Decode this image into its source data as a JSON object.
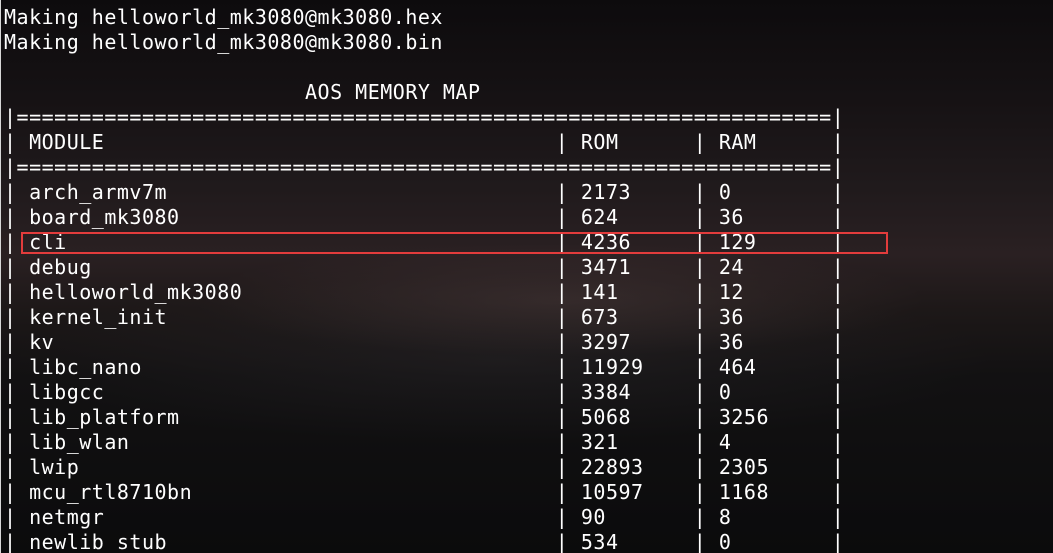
{
  "lines": [
    "Making helloworld_mk3080@mk3080.hex",
    "Making helloworld_mk3080@mk3080.bin",
    "",
    "                        AOS MEMORY MAP",
    "|=================================================================|",
    "| MODULE                                    | ROM      | RAM      |",
    "|=================================================================|",
    "| arch_armv7m                               | 2173     | 0        |",
    "| board_mk3080                              | 624      | 36       |",
    "| cli                                       | 4236     | 129      |",
    "| debug                                     | 3471     | 24       |",
    "| helloworld_mk3080                         | 141      | 12       |",
    "| kernel_init                               | 673      | 36       |",
    "| kv                                        | 3297     | 36       |",
    "| libc_nano                                 | 11929    | 464      |",
    "| libgcc                                    | 3384     | 0        |",
    "| lib_platform                              | 5068     | 3256     |",
    "| lib_wlan                                  | 321      | 4        |",
    "| lwip                                      | 22893    | 2305     |",
    "| mcu_rtl8710bn                             | 10597    | 1168     |",
    "| netmgr                                    | 90       | 8        |",
    "| newlib_stub                               | 534      | 0        |"
  ],
  "colors": {
    "text": "#ffffff",
    "highlight_box": "#e33c3c"
  }
}
